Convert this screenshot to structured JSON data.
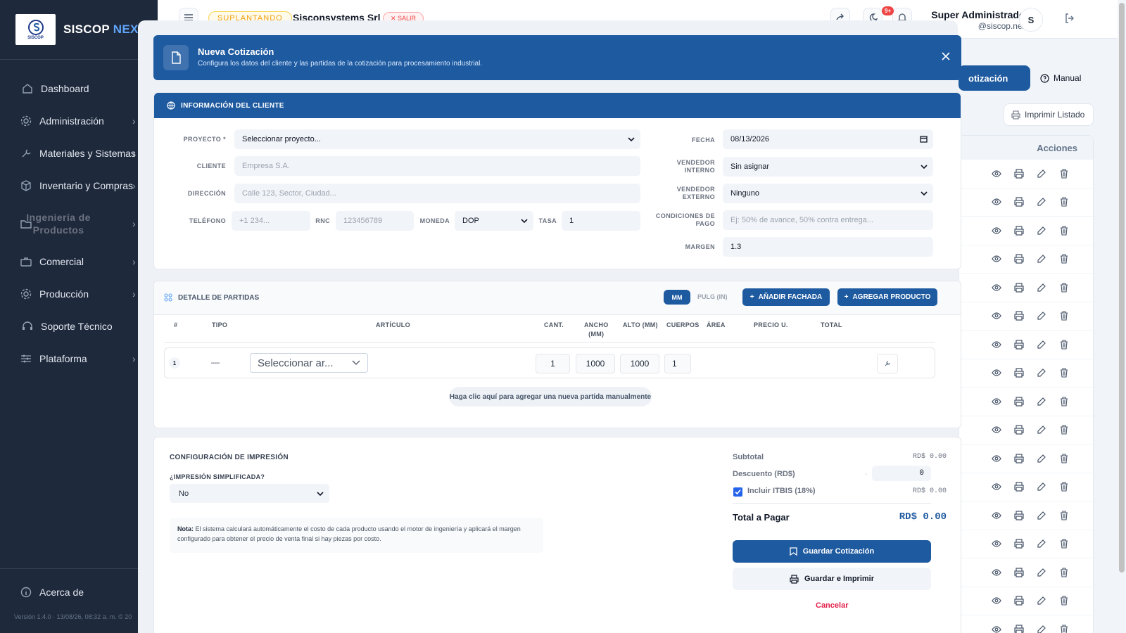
{
  "sidebar": {
    "logo_text": "SISCOP",
    "brand_main": "SISCOP",
    "brand_accent": "NEX",
    "items": [
      {
        "label": "Dashboard",
        "icon": "home-icon"
      },
      {
        "label": "Administración",
        "icon": "gear-icon"
      },
      {
        "label": "Materiales y Sistemas",
        "icon": "wrench-icon"
      },
      {
        "label": "Inventario y Compras",
        "icon": "box-icon"
      },
      {
        "label": "Ingeniería de Productos",
        "icon": "folder-icon"
      },
      {
        "label": "Comercial",
        "icon": "briefcase-icon"
      },
      {
        "label": "Producción",
        "icon": "gear-icon"
      },
      {
        "label": "Soporte Técnico",
        "icon": "headset-icon"
      },
      {
        "label": "Plataforma",
        "icon": "sliders-icon"
      }
    ],
    "about": "Acerca de",
    "version": "Versión 1.4.0 · 13/08/26, 08:32 a. m. © 20"
  },
  "topbar": {
    "impersonating": "SUPLANTANDO",
    "company": "Sisconsystems Srl",
    "exit": "✕ SALIR",
    "notif_count": "9+",
    "user_name": "Super Administrador",
    "user_email": "@siscop.next",
    "avatar_initial": "S"
  },
  "background": {
    "new_button": "otización",
    "manual": "Manual",
    "print_list": "Imprimir Listado",
    "actions_header": "Acciones",
    "row_count": 17
  },
  "modal": {
    "title": "Nueva Cotización",
    "subtitle": "Configura los datos del cliente y las partidas de la cotización para procesamiento industrial.",
    "client_section": "INFORMACIÓN DEL CLIENTE",
    "fields": {
      "proyecto_label": "PROYECTO *",
      "proyecto_value": "Seleccionar proyecto...",
      "cliente_label": "CLIENTE",
      "cliente_placeholder": "Empresa S.A.",
      "direccion_label": "DIRECCIÓN",
      "direccion_placeholder": "Calle 123, Sector, Ciudad...",
      "telefono_label": "TELÉFONO",
      "telefono_placeholder": "+1 234...",
      "rnc_label": "RNC",
      "rnc_placeholder": "123456789",
      "moneda_label": "MONEDA",
      "moneda_value": "DOP",
      "tasa_label": "TASA",
      "tasa_value": "1",
      "fecha_label": "FECHA",
      "fecha_value": "08/13/2026",
      "vend_int_label_1": "VENDEDOR",
      "vend_int_label_2": "INTERNO",
      "vend_int_value": "Sin asignar",
      "vend_ext_label_1": "VENDEDOR",
      "vend_ext_label_2": "EXTERNO",
      "vend_ext_value": "Ninguno",
      "cond_label_1": "CONDICIONES DE",
      "cond_label_2": "PAGO",
      "cond_placeholder": "Ej: 50% de avance, 50% contra entrega...",
      "margen_label": "MARGEN",
      "margen_value": "1.3"
    },
    "details": {
      "title": "DETALLE DE PARTIDAS",
      "unit_mm": "MM",
      "unit_in": "PULG (IN)",
      "add_facade": "AÑADIR FACHADA",
      "add_product": "AGREGAR PRODUCTO",
      "headers": {
        "num": "#",
        "tipo": "TIPO",
        "articulo": "ARTÍCULO",
        "cant": "CANT.",
        "ancho_1": "ANCHO",
        "ancho_2": "(MM)",
        "alto": "ALTO (MM)",
        "cuerpos": "CUERPOS",
        "area": "ÁREA",
        "precio": "PRECIO U.",
        "total": "TOTAL"
      },
      "row": {
        "num": "1",
        "tipo": "—",
        "articulo": "Seleccionar ar...",
        "cant": "1",
        "ancho": "1000",
        "alto": "1000",
        "cuerpos": "1"
      },
      "hint": "Haga clic aquí para agregar una nueva partida manualmente"
    },
    "print_config": {
      "title": "CONFIGURACIÓN DE IMPRESIÓN",
      "simplified_label": "¿IMPRESIÓN SIMPLIFICADA?",
      "simplified_value": "No",
      "note_bold": "Nota:",
      "note_text": " El sistema calculará automáticamente el costo de cada producto usando el motor de ingeniería y aplicará el margen configurado para obtener el precio de venta final si hay piezas por costo."
    },
    "summary": {
      "subtotal_label": "Subtotal",
      "subtotal_value": "RD$ 0.00",
      "discount_label": "Descuento (RD$)",
      "discount_sign": "-",
      "discount_value": "0",
      "itbis_label": "Incluir ITBIS (18%)",
      "itbis_value": "RD$ 0.00",
      "total_label": "Total a Pagar",
      "total_value": "RD$ 0.00",
      "save": "Guardar Cotización",
      "save_print": "Guardar e Imprimir",
      "cancel": "Cancelar"
    }
  },
  "colors": {
    "primary": "#1e5aa0",
    "sidebar": "#1e293b",
    "danger": "#e11d48"
  }
}
